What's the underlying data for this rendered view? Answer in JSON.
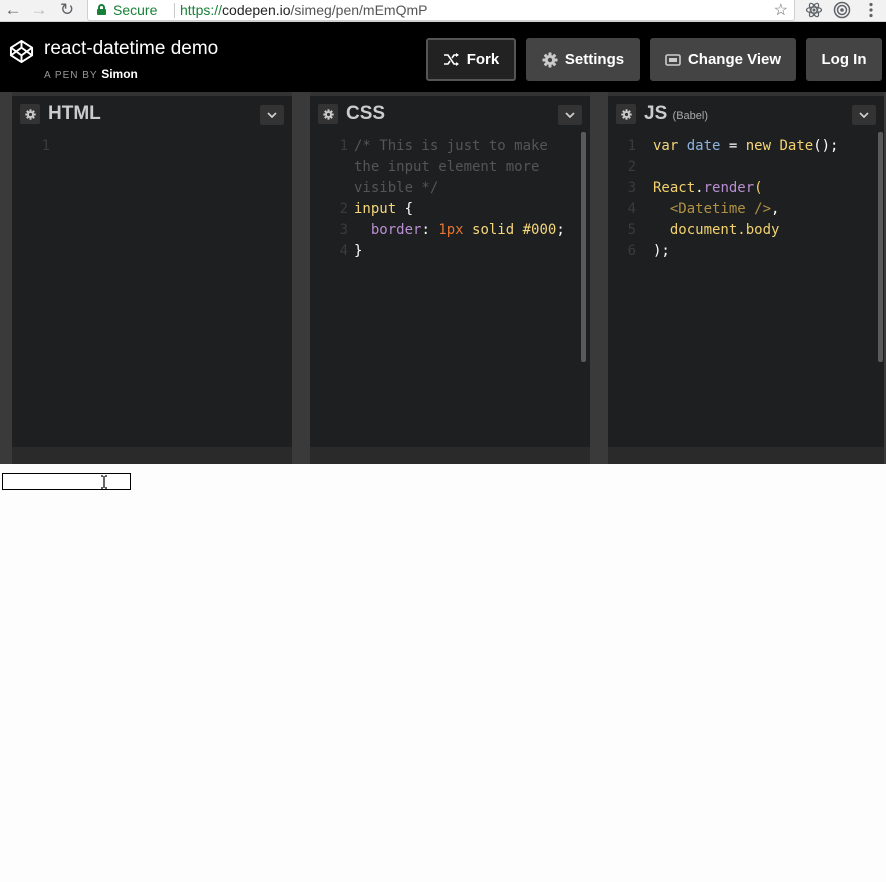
{
  "browser": {
    "back_glyph": "←",
    "forward_glyph": "→",
    "reload_glyph": "↻",
    "secure_label": "Secure",
    "url_scheme": "https://",
    "url_host": "codepen.io",
    "url_path": "/simeg/pen/mEmQmP",
    "star_glyph": "☆",
    "extensions": [
      "react-devtools-icon",
      "target-icon",
      "menu-icon"
    ]
  },
  "header": {
    "pen_title": "react-datetime demo",
    "pen_by_label": "A PEN BY",
    "author": "Simon",
    "buttons": {
      "fork": "Fork",
      "settings": "Settings",
      "change_view": "Change View",
      "log_in": "Log In"
    }
  },
  "editors": {
    "html": {
      "title": "HTML",
      "line_numbers": [
        "1"
      ],
      "lines": [
        ""
      ]
    },
    "css": {
      "title": "CSS",
      "line_numbers": [
        "1",
        "",
        "",
        "2",
        "3",
        "4"
      ],
      "comment_lines": [
        "/* This is just to make",
        "the input element more",
        "visible */"
      ],
      "selector": "input",
      "open_brace": " {",
      "property": "border",
      "colon": ": ",
      "value_num": "1px",
      "value_rest": " solid #000",
      "semicolon": ";",
      "close_brace": "}"
    },
    "js": {
      "title": "JS",
      "subtitle": "(Babel)",
      "line_numbers": [
        "1",
        "2",
        "3",
        "4",
        "5",
        "6"
      ],
      "l1_kw": "var",
      "l1_var": "date",
      "l1_eq": " = ",
      "l1_new": "new",
      "l1_fn": "Date",
      "l1_end": "();",
      "l3_obj": "React",
      "l3_dot": ".",
      "l3_method": "render",
      "l3_paren": "(",
      "l4_tag": "<Datetime />",
      "l4_comma": ",",
      "l5_text": "document.body",
      "l6_text": ");"
    }
  },
  "colors": {
    "accent_green": "#188038",
    "header_bg": "#000000",
    "editor_bg": "#1d1f20"
  }
}
